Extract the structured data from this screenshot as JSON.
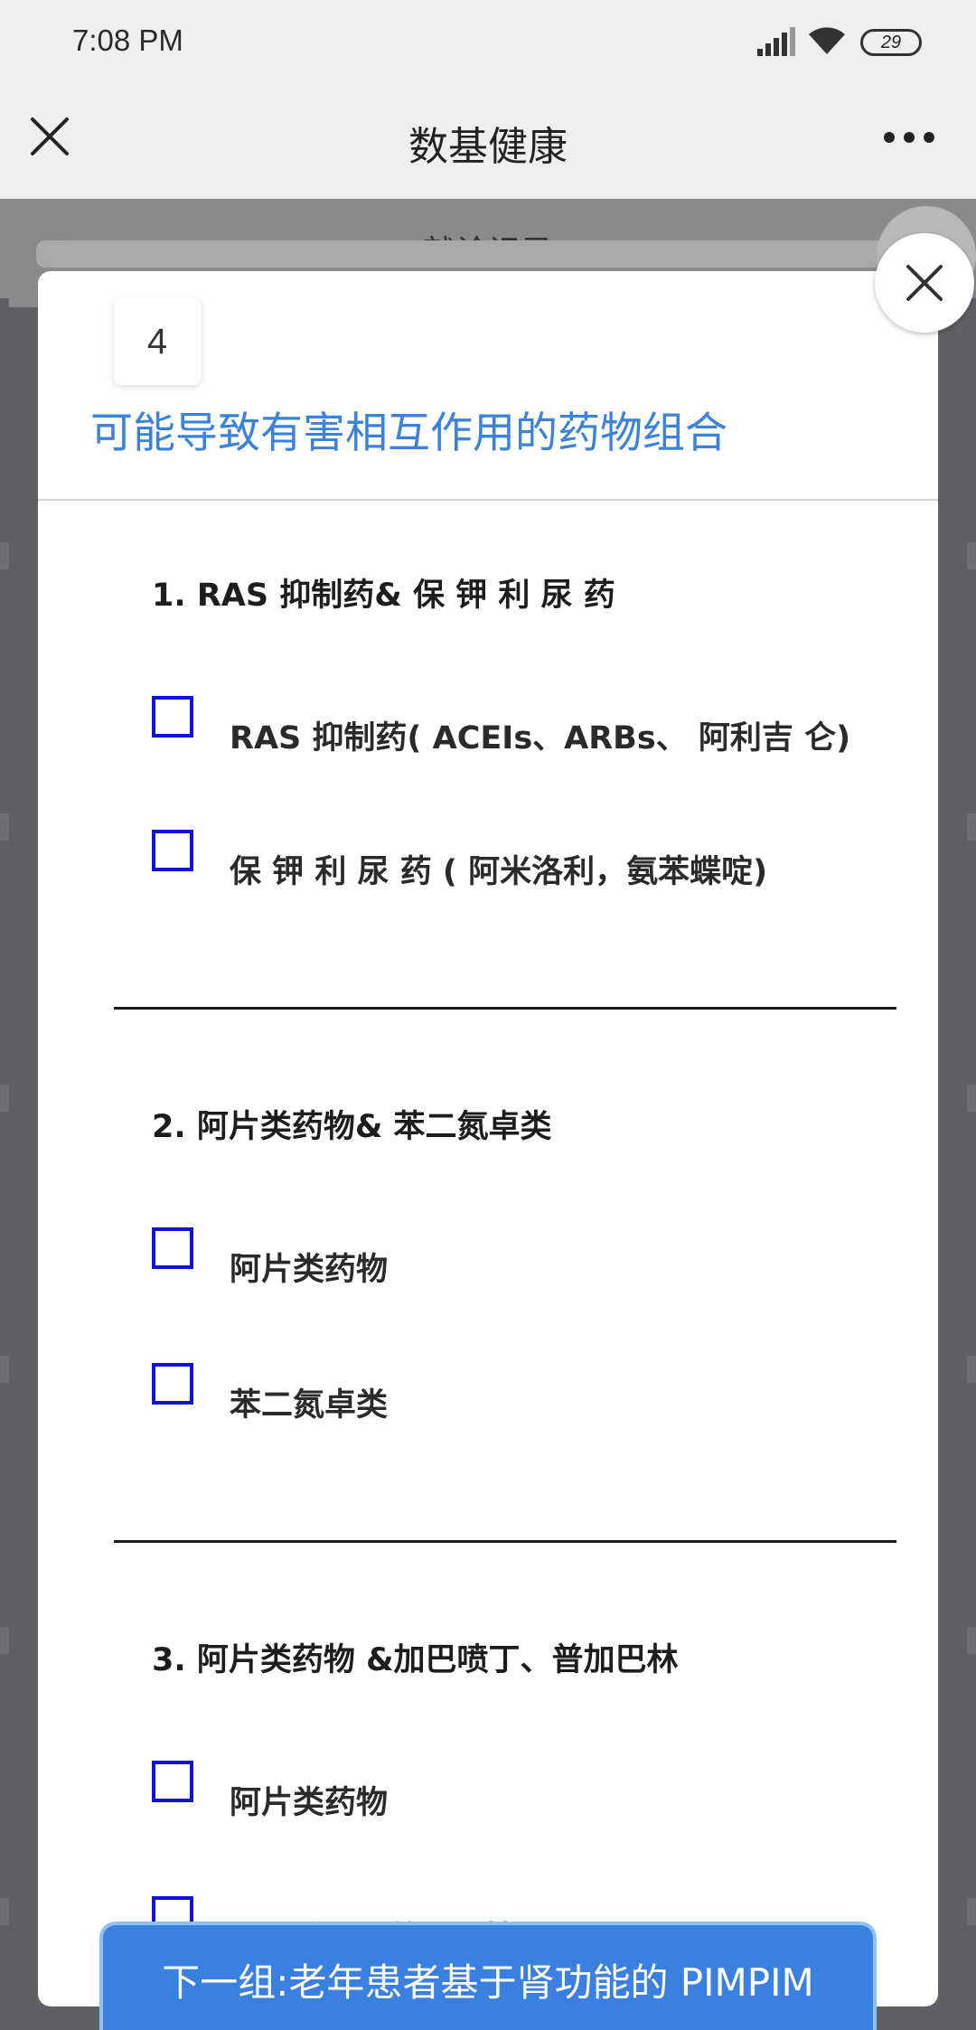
{
  "status_bar": {
    "time": "7:08 PM",
    "battery": "29"
  },
  "header": {
    "title": "数基健康"
  },
  "behind": {
    "title": "就诊记录",
    "back": "‹"
  },
  "modal": {
    "page_number": "4",
    "title": "可能导致有害相互作用的药物组合",
    "groups": [
      {
        "title": "1. RAS 抑制药& 保 钾 利 尿 药",
        "options": [
          "RAS 抑制药( ACEIs、ARBs、 阿利吉 仑)",
          " 保 钾 利 尿 药 ( 阿米洛利，氨苯蝶啶)"
        ]
      },
      {
        "title": "2. 阿片类药物& 苯二氮卓类",
        "options": [
          "阿片类药物",
          "苯二氮卓类"
        ]
      },
      {
        "title": "3. 阿片类药物 &加巴喷丁、普加巴林",
        "options": [
          "阿片类药物",
          "加巴喷丁、普加巴林"
        ]
      }
    ]
  },
  "next_button": {
    "label": "下一组:老年患者基于肾功能的 PIMPIM"
  }
}
